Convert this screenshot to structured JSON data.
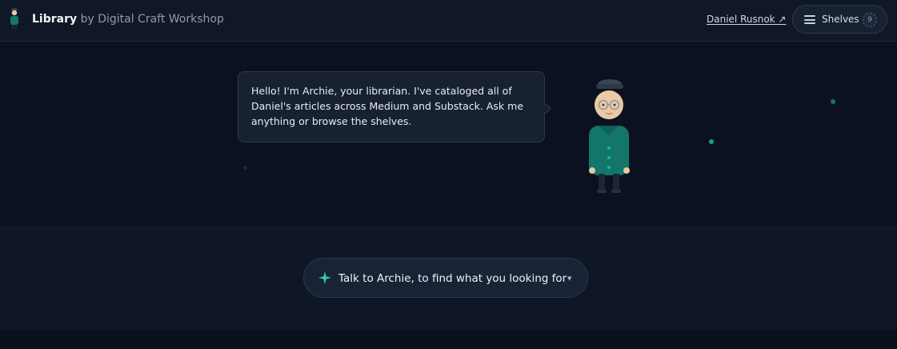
{
  "header": {
    "brand_name": "Library",
    "brand_suffix": "by Digital Craft Workshop",
    "author_link": "Daniel Rusnok ↗",
    "shelves_label": "Shelves",
    "shelves_count": "9"
  },
  "hero": {
    "message": "Hello! I'm Archie, your librarian. I've cataloged all of Daniel's articles across Medium and Substack. Ask me anything or browse the shelves."
  },
  "prompt": {
    "label": "Talk to Archie, to find what you looking for",
    "caret": "▼"
  },
  "icons": [
    "librarian-logo-icon",
    "menu-icon",
    "sparkle-icon",
    "chevron-down-icon",
    "librarian-avatar"
  ],
  "colors": {
    "background": "#0b1020",
    "header": "#101827",
    "panel": "#172131",
    "accent_teal": "#12776a",
    "sparkle": "#2fcfb4"
  }
}
